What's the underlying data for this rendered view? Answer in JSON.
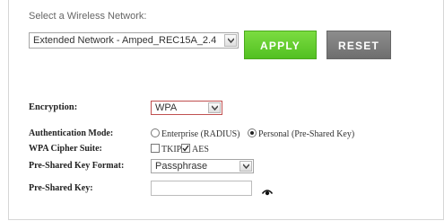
{
  "network": {
    "label": "Select a Wireless Network:",
    "selected": "Extended Network - Amped_REC15A_2.4"
  },
  "buttons": {
    "apply": "APPLY",
    "reset": "RESET"
  },
  "form": {
    "encryption": {
      "label": "Encryption:",
      "value": "WPA"
    },
    "auth_mode": {
      "label": "Authentication Mode:",
      "options": [
        {
          "label": "Enterprise (RADIUS)",
          "selected": false
        },
        {
          "label": "Personal (Pre-Shared Key)",
          "selected": true
        }
      ]
    },
    "cipher": {
      "label": "WPA Cipher Suite:",
      "options": [
        {
          "label": "TKIP",
          "checked": false
        },
        {
          "label": "AES",
          "checked": true
        }
      ]
    },
    "key_format": {
      "label": "Pre-Shared Key Format:",
      "value": "Passphrase"
    },
    "key": {
      "label": "Pre-Shared Key:",
      "value": "",
      "reveal_icon": "eye-icon"
    }
  },
  "colors": {
    "apply_green": "#5cc72a",
    "reset_gray": "#7a7a7a"
  }
}
